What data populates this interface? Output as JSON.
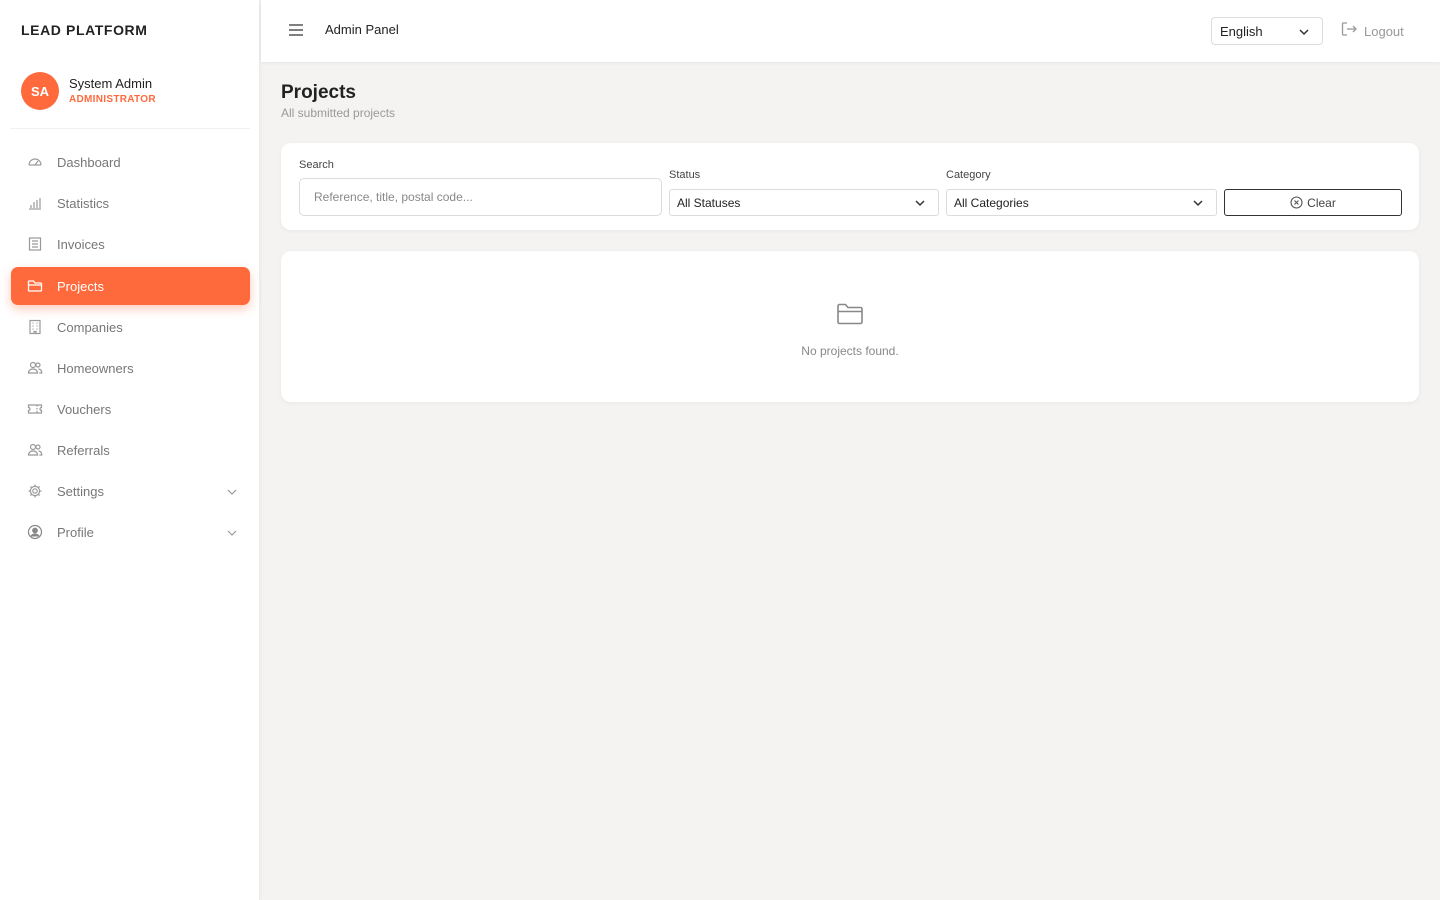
{
  "sidebar": {
    "brand": "LEAD PLATFORM",
    "user": {
      "initials": "SA",
      "name": "System Admin",
      "role": "ADMINISTRATOR"
    },
    "items": [
      {
        "label": "Dashboard",
        "icon": "dashboard-icon",
        "active": false
      },
      {
        "label": "Statistics",
        "icon": "bar-chart-icon",
        "active": false
      },
      {
        "label": "Invoices",
        "icon": "invoice-icon",
        "active": false
      },
      {
        "label": "Projects",
        "icon": "folder-icon",
        "active": true
      },
      {
        "label": "Companies",
        "icon": "building-icon",
        "active": false
      },
      {
        "label": "Homeowners",
        "icon": "users-icon",
        "active": false
      },
      {
        "label": "Vouchers",
        "icon": "ticket-icon",
        "active": false
      },
      {
        "label": "Referrals",
        "icon": "users-icon",
        "active": false
      },
      {
        "label": "Settings",
        "icon": "gear-icon",
        "active": false,
        "expandable": true
      },
      {
        "label": "Profile",
        "icon": "user-circle-icon",
        "active": false,
        "expandable": true
      }
    ]
  },
  "header": {
    "title": "Admin Panel",
    "language": "English",
    "logout_label": "Logout"
  },
  "page": {
    "title": "Projects",
    "subtitle": "All submitted projects"
  },
  "filters": {
    "search_label": "Search",
    "search_placeholder": "Reference, title, postal code...",
    "search_value": "",
    "status_label": "Status",
    "status_value": "All Statuses",
    "category_label": "Category",
    "category_value": "All Categories",
    "clear_label": "Clear"
  },
  "results": {
    "empty_message": "No projects found."
  },
  "colors": {
    "accent": "#ff6a3d",
    "background": "#f4f3f1"
  }
}
